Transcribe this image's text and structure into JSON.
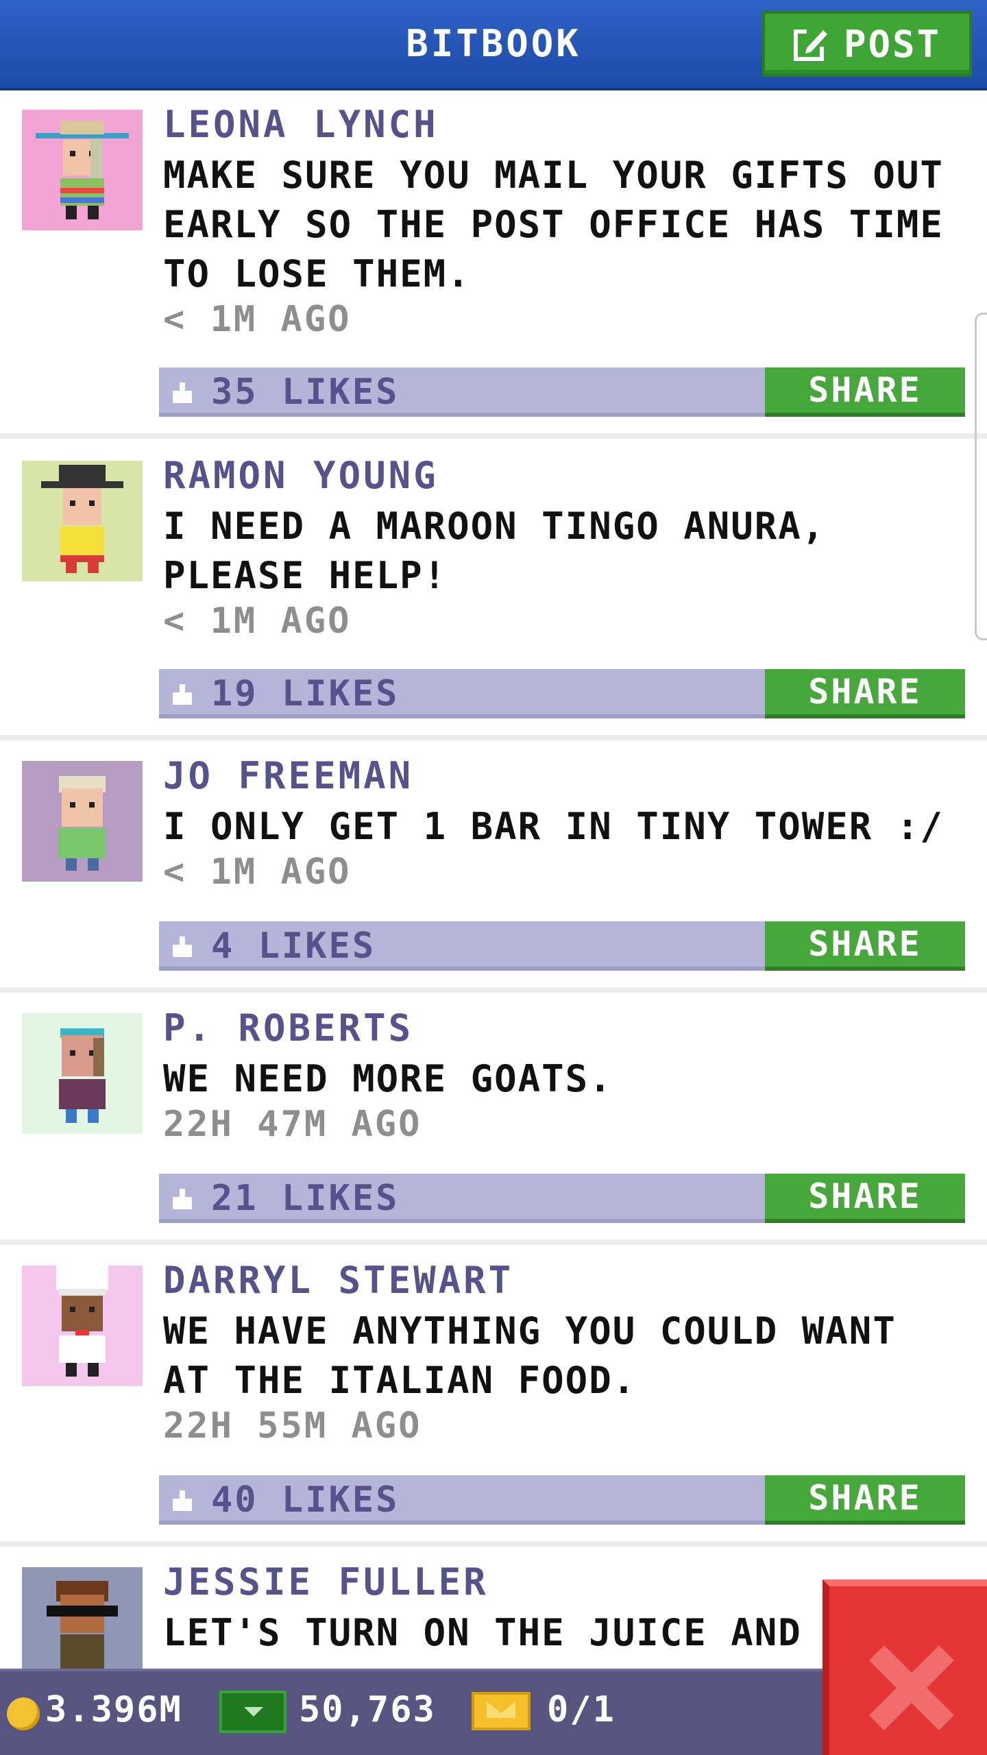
{
  "header": {
    "title": "BITBOOK",
    "post_label": "POST"
  },
  "posts": [
    {
      "author": "LEONA LYNCH",
      "message": "MAKE SURE YOU MAIL YOUR GIFTS OUT EARLY SO THE POST OFFICE HAS TIME TO LOSE THEM.",
      "time": "< 1M AGO",
      "likes": "35 LIKES",
      "share": "SHARE",
      "avatar_bg": "#f2a3d6"
    },
    {
      "author": "RAMON YOUNG",
      "message": "I NEED A MAROON TINGO ANURA, PLEASE HELP!",
      "time": "< 1M AGO",
      "likes": "19 LIKES",
      "share": "SHARE",
      "avatar_bg": "#d7e6a8"
    },
    {
      "author": "JO FREEMAN",
      "message": "I ONLY GET 1 BAR IN TINY TOWER :/",
      "time": "< 1M AGO",
      "likes": "4 LIKES",
      "share": "SHARE",
      "avatar_bg": "#b79cc1"
    },
    {
      "author": "P. ROBERTS",
      "message": "WE NEED MORE GOATS.",
      "time": "22H 47M AGO",
      "likes": "21 LIKES",
      "share": "SHARE",
      "avatar_bg": "#e3f6e3"
    },
    {
      "author": "DARRYL STEWART",
      "message": "WE HAVE ANYTHING YOU COULD WANT AT THE ITALIAN FOOD.",
      "time": "22H 55M AGO",
      "likes": "40 LIKES",
      "share": "SHARE",
      "avatar_bg": "#f6c7ec"
    },
    {
      "author": "JESSIE FULLER",
      "message": "LET'S TURN ON THE JUICE AND S",
      "time": "",
      "likes": "",
      "share": "",
      "avatar_bg": "#8f97b7"
    }
  ],
  "bottom_bar": {
    "coins": "3.396M",
    "bux": "50,763",
    "tickets": "0/1"
  },
  "colors": {
    "header": "#2f62c6",
    "accent_green": "#46a83b",
    "likes_bar": "#b4b5d9",
    "author_text": "#56528c",
    "bottom_bar": "#57557f",
    "close_red": "#e33535"
  },
  "icons": {
    "post": "edit-icon",
    "like": "thumbs-up-icon",
    "coin": "coin-icon",
    "bux": "bux-icon",
    "ticket": "ticket-icon",
    "close": "close-icon"
  }
}
